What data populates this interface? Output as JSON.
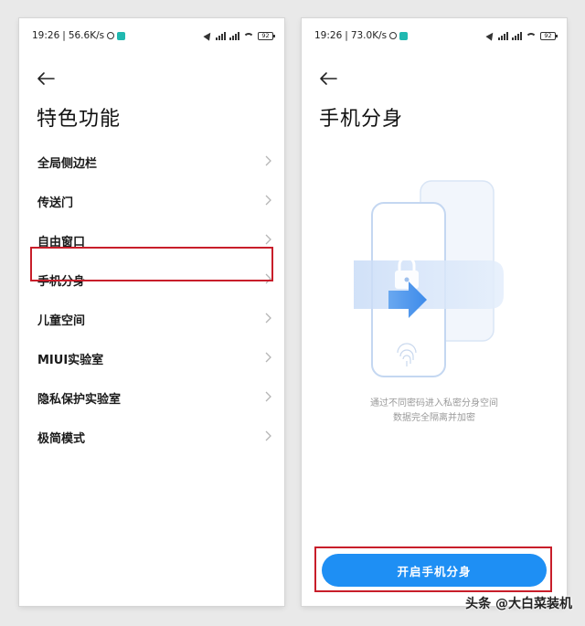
{
  "left_screen": {
    "status": {
      "time": "19:26",
      "speed": "56.6K/s",
      "battery": "92"
    },
    "title": "特色功能",
    "menu_items": [
      {
        "label": "全局侧边栏"
      },
      {
        "label": "传送门"
      },
      {
        "label": "自由窗口"
      },
      {
        "label": "手机分身"
      },
      {
        "label": "儿童空间"
      },
      {
        "label": "MIUI实验室"
      },
      {
        "label": "隐私保护实验室"
      },
      {
        "label": "极简模式"
      }
    ],
    "highlighted_item": "手机分身"
  },
  "right_screen": {
    "status": {
      "time": "19:26",
      "speed": "73.0K/s",
      "battery": "92"
    },
    "title": "手机分身",
    "description_line1": "通过不同密码进入私密分身空间",
    "description_line2": "数据完全隔离并加密",
    "button_label": "开启手机分身"
  },
  "watermark": "头条 @大白菜装机",
  "colors": {
    "accent_blue": "#1e8ff4",
    "highlight_red": "#c81e2a",
    "badge_teal": "#20b8b0"
  },
  "icons": [
    "back-arrow-icon",
    "chevron-right-icon",
    "lock-icon",
    "fingerprint-icon",
    "arrow-right-icon",
    "wifi-icon",
    "signal-icon",
    "battery-icon",
    "location-icon",
    "alarm-icon"
  ]
}
